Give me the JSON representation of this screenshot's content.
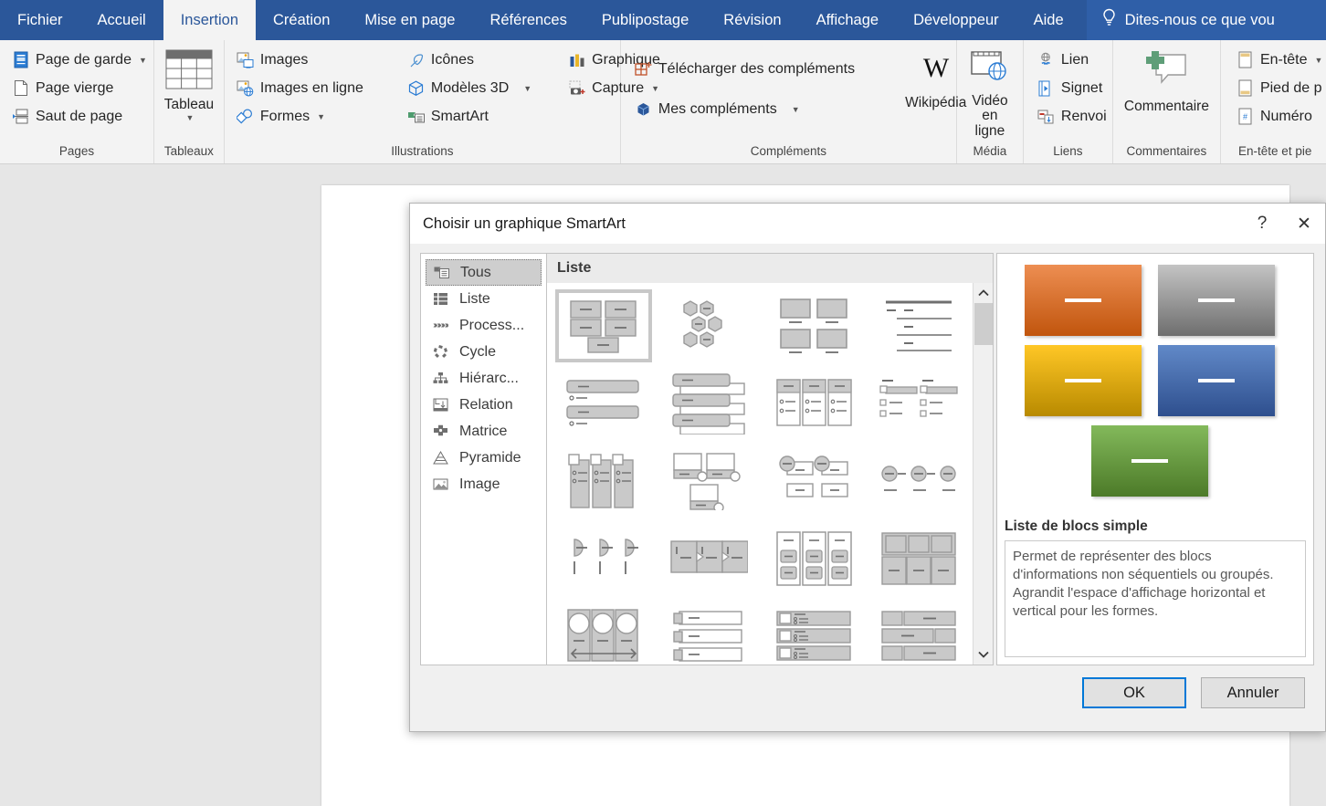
{
  "ribbon": {
    "tabs": [
      {
        "label": "Fichier",
        "active": false
      },
      {
        "label": "Accueil",
        "active": false
      },
      {
        "label": "Insertion",
        "active": true
      },
      {
        "label": "Création",
        "active": false
      },
      {
        "label": "Mise en page",
        "active": false
      },
      {
        "label": "Références",
        "active": false
      },
      {
        "label": "Publipostage",
        "active": false
      },
      {
        "label": "Révision",
        "active": false
      },
      {
        "label": "Affichage",
        "active": false
      },
      {
        "label": "Développeur",
        "active": false
      },
      {
        "label": "Aide",
        "active": false
      }
    ],
    "tellme": "Dites-nous ce que vou",
    "tellme_icon": "lightbulb-icon",
    "groups": [
      {
        "name": "Pages",
        "items": [
          "Page de garde",
          "Page vierge",
          "Saut de page"
        ]
      },
      {
        "name": "Tableaux",
        "items": [
          "Tableau"
        ]
      },
      {
        "name": "Illustrations",
        "items": [
          "Images",
          "Images en ligne",
          "Formes",
          "Icônes",
          "Modèles 3D",
          "SmartArt",
          "Graphique",
          "Capture"
        ]
      },
      {
        "name": "Compléments",
        "items": [
          "Télécharger des compléments",
          "Mes compléments",
          "Wikipédia"
        ]
      },
      {
        "name": "Média",
        "items": [
          "Vidéo en ligne"
        ]
      },
      {
        "name": "Liens",
        "items": [
          "Lien",
          "Signet",
          "Renvoi"
        ]
      },
      {
        "name": "Commentaires",
        "items": [
          "Commentaire"
        ]
      },
      {
        "name": "En-tête et pie",
        "items": [
          "En-tête",
          "Pied de p",
          "Numéro "
        ]
      }
    ],
    "labels": {
      "pages": "Pages",
      "tableaux": "Tableaux",
      "illustrations": "Illustrations",
      "complements": "Compléments",
      "media": "Média",
      "liens": "Liens",
      "commentaires": "Commentaires",
      "entete": "En-tête et pie"
    },
    "buttons": {
      "page_de_garde": "Page de garde",
      "page_vierge": "Page vierge",
      "saut_de_page": "Saut de page",
      "tableau": "Tableau",
      "images": "Images",
      "images_en_ligne": "Images en ligne",
      "formes": "Formes",
      "icones": "Icônes",
      "modeles_3d": "Modèles 3D",
      "smartart": "SmartArt",
      "graphique": "Graphique",
      "capture": "Capture",
      "telecharger_complements": "Télécharger des compléments",
      "mes_complements": "Mes compléments",
      "wikipedia": "Wikipédia",
      "video_en_ligne": "Vidéo\nen ligne",
      "video_line1": "Vidéo",
      "video_line2": "en ligne",
      "lien": "Lien",
      "signet": "Signet",
      "renvoi": "Renvoi",
      "commentaire": "Commentaire",
      "en_tete": "En-tête",
      "pied_de_page": "Pied de p",
      "numero": "Numéro "
    }
  },
  "dialog": {
    "title": "Choisir un graphique SmartArt",
    "help_label": "?",
    "close_label": "✕",
    "categories": [
      {
        "label": "Tous",
        "icon": "all-smartart-icon",
        "selected": true
      },
      {
        "label": "Liste",
        "icon": "list-icon",
        "selected": false
      },
      {
        "label": "Process...",
        "icon": "process-icon",
        "selected": false
      },
      {
        "label": "Cycle",
        "icon": "cycle-icon",
        "selected": false
      },
      {
        "label": "Hiérarc...",
        "icon": "hierarchy-icon",
        "selected": false
      },
      {
        "label": "Relation",
        "icon": "relationship-icon",
        "selected": false
      },
      {
        "label": "Matrice",
        "icon": "matrix-icon",
        "selected": false
      },
      {
        "label": "Pyramide",
        "icon": "pyramid-icon",
        "selected": false
      },
      {
        "label": "Image",
        "icon": "picture-icon",
        "selected": false
      }
    ],
    "gallery_header": "Liste",
    "gallery_items": [
      {
        "id": "liste-blocs-simple",
        "selected": true
      },
      {
        "id": "liste-alveoles",
        "selected": false
      },
      {
        "id": "liste-images-legendees",
        "selected": false
      },
      {
        "id": "liste-lignes",
        "selected": false
      },
      {
        "id": "liste-verticale-puces",
        "selected": false
      },
      {
        "id": "liste-chevron-vertical",
        "selected": false
      },
      {
        "id": "liste-colonnes-encadrees",
        "selected": false
      },
      {
        "id": "liste-tableau-onglets",
        "selected": false
      },
      {
        "id": "liste-blocs-verticaux",
        "selected": false
      },
      {
        "id": "liste-images-cercles",
        "selected": false
      },
      {
        "id": "liste-cercles-texte",
        "selected": false
      },
      {
        "id": "liste-cercles-ligne",
        "selected": false
      },
      {
        "id": "liste-demi-cercles",
        "selected": false
      },
      {
        "id": "liste-fleches-process",
        "selected": false
      },
      {
        "id": "liste-colonnes-groupees",
        "selected": false
      },
      {
        "id": "liste-grille-blocs",
        "selected": false
      },
      {
        "id": "liste-cercles-fleche",
        "selected": false
      },
      {
        "id": "liste-onglets-lignes",
        "selected": false
      },
      {
        "id": "liste-images-barres",
        "selected": false
      },
      {
        "id": "liste-mosaique",
        "selected": false
      }
    ],
    "scrollbar": {
      "up": "▲",
      "down": "▼"
    },
    "preview": {
      "title": "Liste de blocs simple",
      "description": "Permet de représenter des blocs d'informations non séquentiels ou groupés. Agrandit l'espace d'affichage horizontal et vertical pour les formes.",
      "blocks": [
        {
          "name": "block-orange",
          "color_top": "#ED8E52",
          "color_bottom": "#C1550D"
        },
        {
          "name": "block-gray",
          "color_top": "#BFBFBF",
          "color_bottom": "#6E6E6E"
        },
        {
          "name": "block-yellow",
          "color_top": "#FFC726",
          "color_bottom": "#B88A00"
        },
        {
          "name": "block-blue",
          "color_top": "#6189C8",
          "color_bottom": "#2E4F8E"
        },
        {
          "name": "block-green",
          "color_top": "#7FB košt"
        }
      ]
    },
    "buttons": {
      "ok": "OK",
      "cancel": "Annuler"
    }
  },
  "colors": {
    "ribbon_blue": "#2b579a",
    "accent_focus": "#0078d7",
    "orange_top": "#ED8E52",
    "orange_bottom": "#C1550D",
    "gray_top": "#BFBFBF",
    "gray_bottom": "#6E6E6E",
    "yellow_top": "#FFC726",
    "yellow_bottom": "#B88A00",
    "blue_top": "#6189C8",
    "blue_bottom": "#2E4F8E",
    "green_top": "#7FB552",
    "green_bottom": "#4C7A28"
  }
}
